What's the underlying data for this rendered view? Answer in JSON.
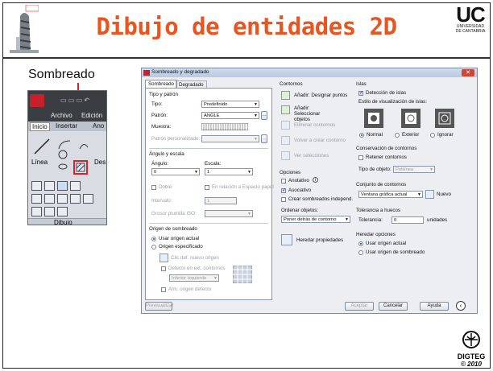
{
  "header": {
    "title": "Dibujo de entidades 2D",
    "uc_logo": "UC",
    "uc_sub1": "UNIVERSIDAD",
    "uc_sub2": "DE CANTABRIA"
  },
  "callout": {
    "label": "Sombreado"
  },
  "ribbon": {
    "tab_archivo": "Archivo",
    "tab_edicion": "Edición",
    "tab_inicio": "Inicio",
    "tab_insertar": "Insertar",
    "tab_ano": "Ano",
    "linea": "Línea",
    "des": "Des",
    "panel": "Dibujo"
  },
  "dialog": {
    "title": "Sombreado y degradado",
    "tab1": "Sombreado",
    "tab2": "Degradado",
    "tipo_patron": "Tipo y patrón",
    "tipo_label": "Tipo:",
    "tipo_value": "Predefinido",
    "patron_label": "Patrón:",
    "patron_value": "ANGLE",
    "muestra_label": "Muestra:",
    "patron_pers_label": "Patrón personalizado:",
    "angulo_escala": "Ángulo y escala",
    "angulo_label": "Ángulo:",
    "angulo_value": "0",
    "escala_label": "Escala:",
    "escala_value": "1",
    "doble": "Doble",
    "relacion": "En relación a Espacio papel",
    "intervalo_label": "Intervalo:",
    "intervalo_value": "1",
    "grosor_label": "Grosor plumilla ISO:",
    "origen": "Origen de sombreado",
    "usar_origen": "Usar origen actual",
    "origen_esp": "Origen especificado",
    "clic_origen": "Clic def. nuevo origen",
    "defecto_ext": "Defecto en ext. contornos",
    "inferior_izq": "Inferior izquierdo",
    "alm_origen": "Alm. origen defecto",
    "contornos": "Contornos",
    "add_puntos": "Añadir: Designar puntos",
    "add_objetos": "Añadir: Seleccionar objetos",
    "eliminar": "Eliminar contornos",
    "volver": "Volver a crear contorno",
    "ver_sel": "Ver selecciones",
    "opciones": "Opciones",
    "anotativo": "Anotativo",
    "asociativo": "Asociativo",
    "crear_indep": "Crear sombreados independ.",
    "ordenar": "Ordenar objetos:",
    "ordenar_value": "Poner detrás de contorno",
    "heredar_prop": "Heredar propiedades",
    "islas": "Islas",
    "deteccion": "Detección de islas",
    "estilo_vis": "Estilo de visualización de islas:",
    "normal": "Normal",
    "exterior": "Exterior",
    "ignorar": "Ignorar",
    "conservacion": "Conservación de contornos",
    "retener": "Retener contornos",
    "tipo_objeto": "Tipo de objeto:",
    "tipo_objeto_value": "Polilínea",
    "conjunto": "Conjunto de contornos",
    "ventana": "Ventana gráfica actual",
    "nuevo": "Nuevo",
    "tolerancia_huecos": "Tolerancia a huecos",
    "tolerancia_label": "Tolerancia:",
    "tolerancia_value": "0",
    "unidades": "unidades",
    "heredar_opc": "Heredar opciones",
    "her_usar": "Usar origen actual",
    "her_origen": "Usar origen de sombreado",
    "previsualizar": "Previsualizar",
    "aceptar": "Aceptar",
    "cancelar": "Cancelar",
    "ayuda": "Ayuda"
  },
  "footer": {
    "name": "DIGTEG",
    "year": "© 2010"
  }
}
